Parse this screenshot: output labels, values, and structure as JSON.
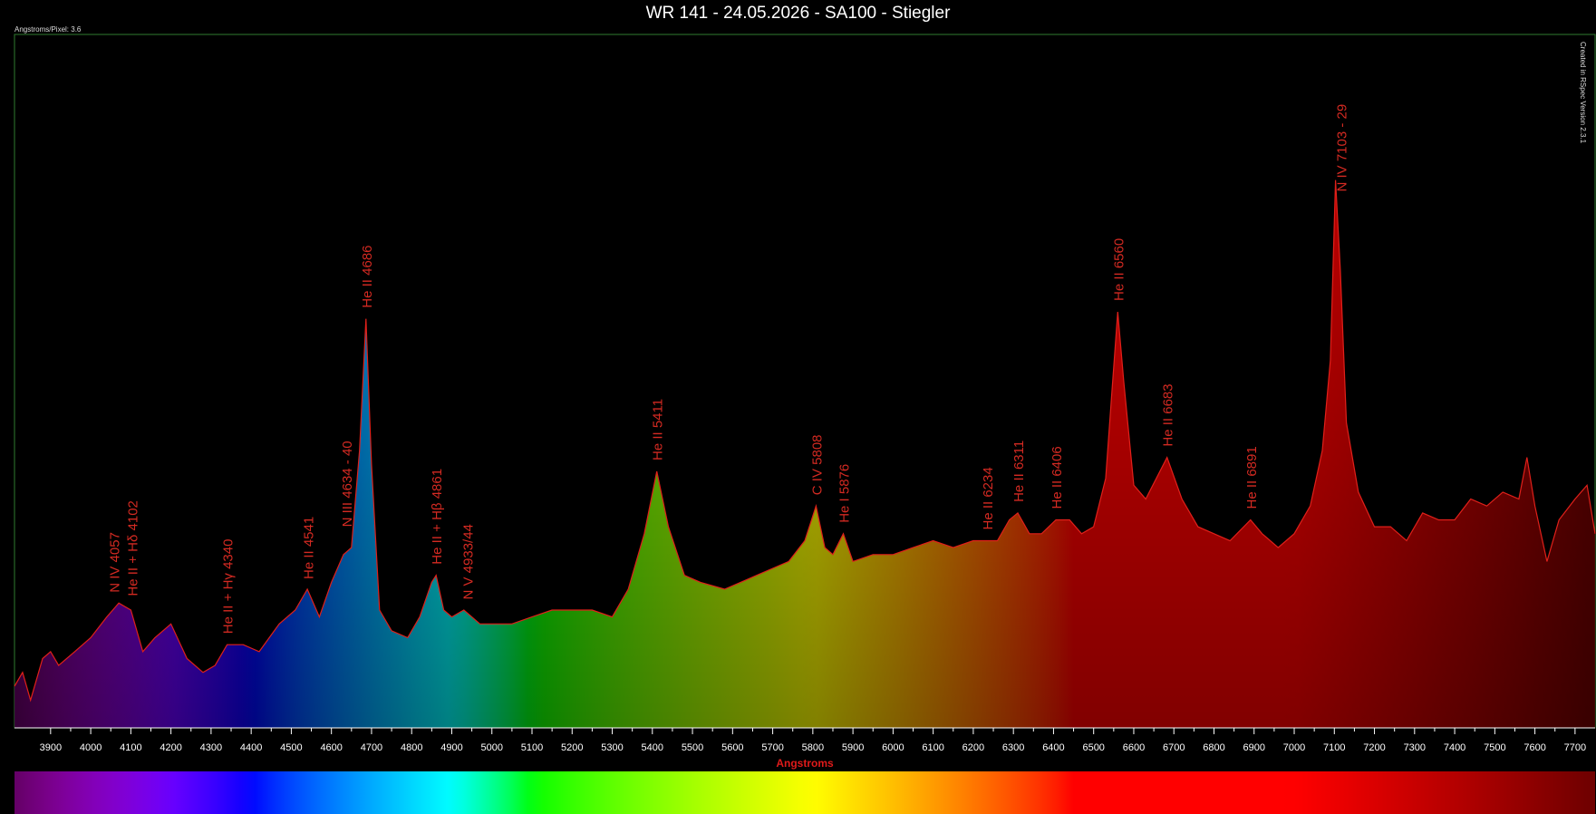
{
  "window": {
    "title": "WR 141 - 24.05.2026 - SA100 - Stiegler",
    "angstroms_per_pixel": "Angstroms/Pixel: 3.6",
    "created_by": "Created in RSpec Version 2.3.1"
  },
  "colors": {
    "background": "#000000",
    "spectrum_line": "#e0201a",
    "annotation": "#d42a22",
    "axis_title": "#e01a1a",
    "frame": "#2f7d2f",
    "axis": "#ffffff"
  },
  "chart_data": {
    "type": "line",
    "title": "WR 141 - 24.05.2026 - SA100 - Stiegler",
    "xlabel": "Angstroms",
    "ylabel": "",
    "xlim": [
      3810,
      7750
    ],
    "ylim": [
      0,
      1.0
    ],
    "grid": false,
    "fill": "rainbow-spectrum",
    "x_ticks": [
      "3900",
      "4000",
      "4100",
      "4200",
      "4300",
      "4400",
      "4500",
      "4600",
      "4700",
      "4800",
      "4900",
      "5000",
      "5100",
      "5200",
      "5300",
      "5400",
      "5500",
      "5600",
      "5700",
      "5800",
      "5900",
      "6000",
      "6100",
      "6200",
      "6300",
      "6400",
      "6500",
      "6600",
      "6700",
      "6800",
      "6900",
      "7000",
      "7100",
      "7200",
      "7300",
      "7400",
      "7500",
      "7600",
      "7700"
    ],
    "series": [
      {
        "x": [
          3810,
          3830,
          3850,
          3880,
          3900,
          3920,
          3960,
          4000,
          4040,
          4070,
          4100,
          4130,
          4160,
          4200,
          4240,
          4280,
          4310,
          4340,
          4380,
          4420,
          4470,
          4510,
          4540,
          4570,
          4600,
          4630,
          4650,
          4670,
          4686,
          4700,
          4720,
          4750,
          4790,
          4820,
          4850,
          4861,
          4880,
          4900,
          4930,
          4970,
          5000,
          5050,
          5100,
          5150,
          5200,
          5250,
          5300,
          5340,
          5380,
          5411,
          5440,
          5480,
          5520,
          5580,
          5620,
          5660,
          5700,
          5740,
          5780,
          5808,
          5830,
          5850,
          5876,
          5900,
          5950,
          6000,
          6050,
          6100,
          6150,
          6200,
          6234,
          6260,
          6290,
          6311,
          6340,
          6370,
          6406,
          6440,
          6470,
          6500,
          6530,
          6545,
          6560,
          6575,
          6600,
          6630,
          6683,
          6720,
          6760,
          6800,
          6840,
          6891,
          6920,
          6960,
          7000,
          7040,
          7070,
          7090,
          7103,
          7115,
          7130,
          7160,
          7200,
          7240,
          7280,
          7320,
          7360,
          7400,
          7440,
          7480,
          7520,
          7560,
          7580,
          7600,
          7630,
          7660,
          7700,
          7730,
          7750
        ],
        "y": [
          0.06,
          0.08,
          0.04,
          0.1,
          0.11,
          0.09,
          0.11,
          0.13,
          0.16,
          0.18,
          0.17,
          0.11,
          0.13,
          0.15,
          0.1,
          0.08,
          0.09,
          0.12,
          0.12,
          0.11,
          0.15,
          0.17,
          0.2,
          0.16,
          0.21,
          0.25,
          0.26,
          0.4,
          0.59,
          0.38,
          0.17,
          0.14,
          0.13,
          0.16,
          0.21,
          0.22,
          0.17,
          0.16,
          0.17,
          0.15,
          0.15,
          0.15,
          0.16,
          0.17,
          0.17,
          0.17,
          0.16,
          0.2,
          0.28,
          0.37,
          0.29,
          0.22,
          0.21,
          0.2,
          0.21,
          0.22,
          0.23,
          0.24,
          0.27,
          0.32,
          0.26,
          0.25,
          0.28,
          0.24,
          0.25,
          0.25,
          0.26,
          0.27,
          0.26,
          0.27,
          0.27,
          0.27,
          0.3,
          0.31,
          0.28,
          0.28,
          0.3,
          0.3,
          0.28,
          0.29,
          0.36,
          0.48,
          0.6,
          0.5,
          0.35,
          0.33,
          0.39,
          0.33,
          0.29,
          0.28,
          0.27,
          0.3,
          0.28,
          0.26,
          0.28,
          0.32,
          0.4,
          0.53,
          0.79,
          0.66,
          0.44,
          0.34,
          0.29,
          0.29,
          0.27,
          0.31,
          0.3,
          0.3,
          0.33,
          0.32,
          0.34,
          0.33,
          0.39,
          0.32,
          0.24,
          0.3,
          0.33,
          0.35,
          0.28
        ]
      }
    ],
    "annotations": [
      {
        "label": "N IV 4057",
        "x": 4057
      },
      {
        "label": "He II + Hδ  4102",
        "x": 4102
      },
      {
        "label": "He II + Hγ 4340",
        "x": 4340
      },
      {
        "label": "He II  4541",
        "x": 4541
      },
      {
        "label": "N III  4634 - 40",
        "x": 4637
      },
      {
        "label": "He II  4686",
        "x": 4686
      },
      {
        "label": "He II + Hβ  4861",
        "x": 4861
      },
      {
        "label": "N V 4933/44",
        "x": 4938
      },
      {
        "label": "He II  5411",
        "x": 5411
      },
      {
        "label": "C IV  5808",
        "x": 5808
      },
      {
        "label": "He I  5876",
        "x": 5876
      },
      {
        "label": "He II 6234",
        "x": 6234
      },
      {
        "label": "He II 6311",
        "x": 6311
      },
      {
        "label": "He II 6406",
        "x": 6406
      },
      {
        "label": "He II  6560",
        "x": 6560
      },
      {
        "label": "He II  6683",
        "x": 6683
      },
      {
        "label": "He II 6891",
        "x": 6891
      },
      {
        "label": "N IV  7103 - 29",
        "x": 7116
      }
    ]
  }
}
